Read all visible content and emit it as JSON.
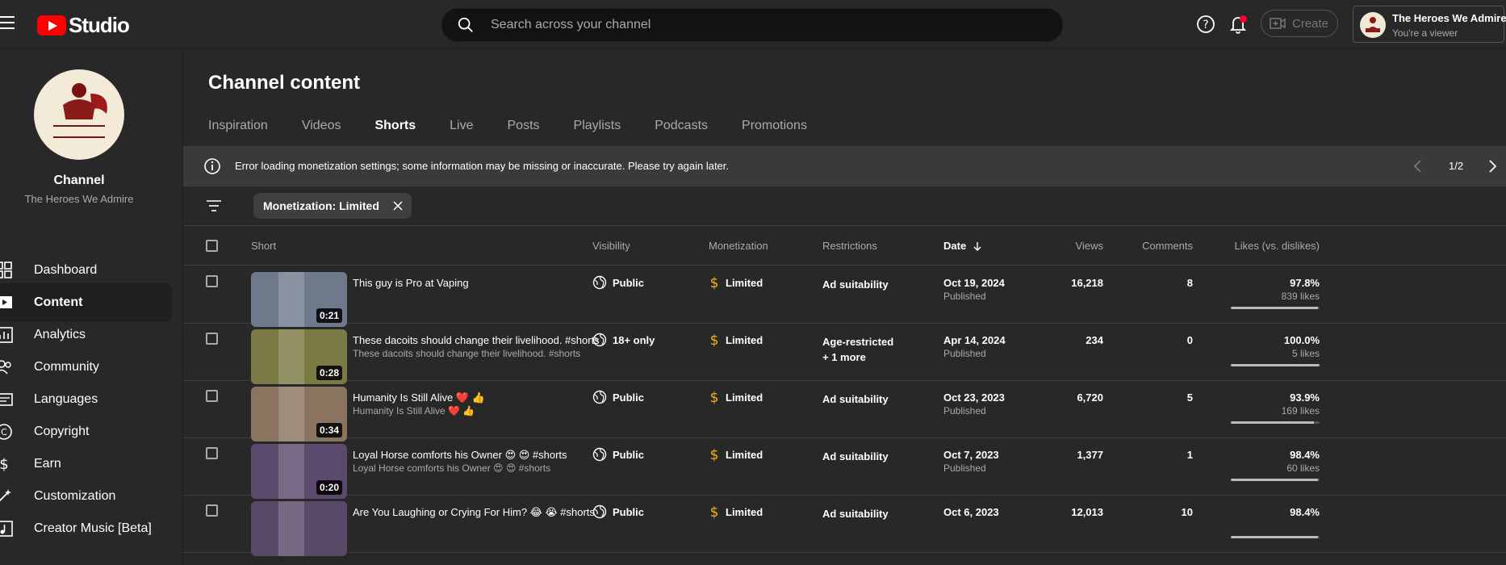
{
  "topbar": {
    "logo_text": "Studio",
    "search_placeholder": "Search across your channel",
    "create_label": "Create",
    "account_name": "The Heroes We Admire",
    "account_role": "You're a viewer"
  },
  "sidebar": {
    "channel_label": "Channel",
    "channel_name": "The Heroes We Admire",
    "items": [
      {
        "label": "Dashboard",
        "icon": "dashboard-icon"
      },
      {
        "label": "Content",
        "icon": "content-icon",
        "active": true
      },
      {
        "label": "Analytics",
        "icon": "analytics-icon"
      },
      {
        "label": "Community",
        "icon": "community-icon"
      },
      {
        "label": "Languages",
        "icon": "languages-icon"
      },
      {
        "label": "Copyright",
        "icon": "copyright-icon"
      },
      {
        "label": "Earn",
        "icon": "earn-icon"
      },
      {
        "label": "Customization",
        "icon": "customization-icon"
      },
      {
        "label": "Creator Music [Beta]",
        "icon": "music-icon"
      }
    ]
  },
  "main": {
    "title": "Channel content",
    "tabs": [
      {
        "label": "Inspiration"
      },
      {
        "label": "Videos"
      },
      {
        "label": "Shorts",
        "active": true
      },
      {
        "label": "Live"
      },
      {
        "label": "Posts"
      },
      {
        "label": "Playlists"
      },
      {
        "label": "Podcasts"
      },
      {
        "label": "Promotions"
      }
    ],
    "banner": {
      "message": "Error loading monetization settings; some information may be missing or inaccurate. Please try again later.",
      "page": "1/2"
    },
    "filter_chip": "Monetization: Limited",
    "columns": {
      "short": "Short",
      "visibility": "Visibility",
      "monetization": "Monetization",
      "restrictions": "Restrictions",
      "date": "Date",
      "views": "Views",
      "comments": "Comments",
      "likes": "Likes (vs. dislikes)"
    },
    "rows": [
      {
        "duration": "0:21",
        "title": "This guy is Pro at Vaping",
        "description": "",
        "visibility": "Public",
        "monetization": "Limited",
        "restriction": "Ad suitability",
        "restriction_more": "",
        "date": "Oct 19, 2024",
        "status": "Published",
        "views": "16,218",
        "comments": "8",
        "likes_pct": "97.8%",
        "likes_count": "839 likes",
        "likes_ratio": 0.978,
        "thumb_color": "#6e7a8c"
      },
      {
        "duration": "0:28",
        "title": "These dacoits should change their livelihood. #shorts",
        "description": "These dacoits should change their livelihood. #shorts",
        "visibility": "18+ only",
        "monetization": "Limited",
        "restriction": "Age-restricted",
        "restriction_more": "+ 1 more",
        "date": "Apr 14, 2024",
        "status": "Published",
        "views": "234",
        "comments": "0",
        "likes_pct": "100.0%",
        "likes_count": "5 likes",
        "likes_ratio": 1.0,
        "thumb_color": "#7a7a44"
      },
      {
        "duration": "0:34",
        "title": "Humanity Is Still Alive ❤️ 👍",
        "description": "Humanity Is Still Alive ❤️ 👍",
        "visibility": "Public",
        "monetization": "Limited",
        "restriction": "Ad suitability",
        "restriction_more": "",
        "date": "Oct 23, 2023",
        "status": "Published",
        "views": "6,720",
        "comments": "5",
        "likes_pct": "93.9%",
        "likes_count": "169 likes",
        "likes_ratio": 0.939,
        "thumb_color": "#8a7460"
      },
      {
        "duration": "0:20",
        "title": "Loyal Horse comforts his Owner 😍 😍  #shorts",
        "description": "Loyal Horse comforts his Owner 😍 😍 #shorts",
        "visibility": "Public",
        "monetization": "Limited",
        "restriction": "Ad suitability",
        "restriction_more": "",
        "date": "Oct 7, 2023",
        "status": "Published",
        "views": "1,377",
        "comments": "1",
        "likes_pct": "98.4%",
        "likes_count": "60 likes",
        "likes_ratio": 0.984,
        "thumb_color": "#5c4a6e"
      },
      {
        "duration": "",
        "title": "Are You Laughing or Crying For Him? 😂 😭 #shorts",
        "description": "",
        "visibility": "Public",
        "monetization": "Limited",
        "restriction": "Ad suitability",
        "restriction_more": "",
        "date": "Oct 6, 2023",
        "status": "",
        "views": "12,013",
        "comments": "10",
        "likes_pct": "98.4%",
        "likes_count": "",
        "likes_ratio": 0.984,
        "thumb_color": "#5a4868"
      }
    ]
  }
}
